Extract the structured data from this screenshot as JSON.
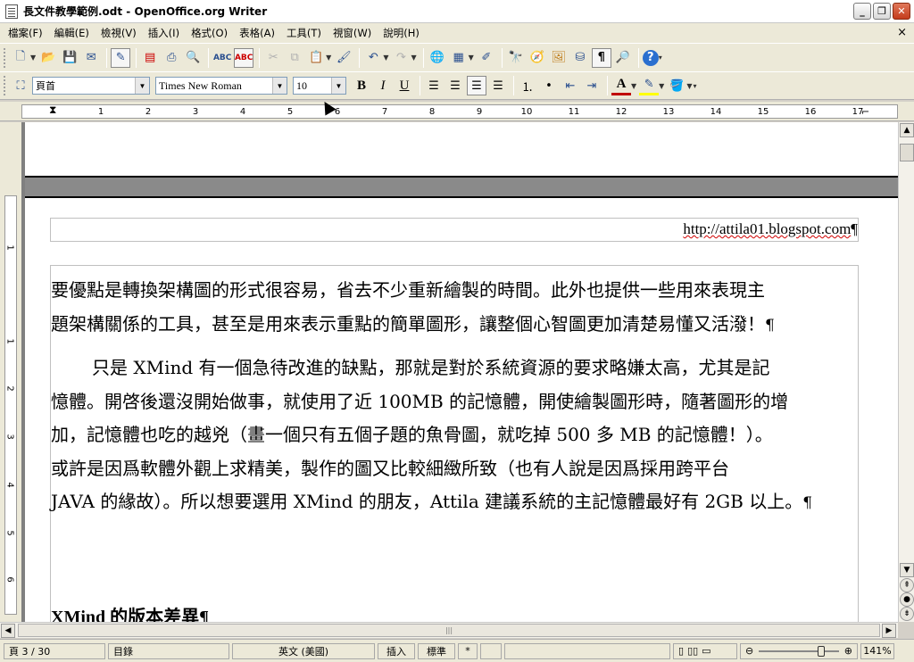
{
  "window": {
    "title": "長文件教學範例.odt - OpenOffice.org Writer",
    "minimize": "_",
    "restore": "❐",
    "close": "✕"
  },
  "menu": {
    "items": [
      "檔案(F)",
      "編輯(E)",
      "檢視(V)",
      "插入(I)",
      "格式(O)",
      "表格(A)",
      "工具(T)",
      "視窗(W)",
      "說明(H)"
    ],
    "close_doc": "×"
  },
  "formatting": {
    "paragraph_style": "頁首",
    "font_name": "Times New Roman",
    "font_size": "10",
    "bold": "B",
    "italic": "I",
    "underline": "U",
    "font_color_letter": "A"
  },
  "ruler": {
    "numbers": [
      "1",
      "2",
      "3",
      "4",
      "5",
      "6",
      "7",
      "8",
      "9",
      "10",
      "11",
      "12",
      "13",
      "14",
      "15",
      "16",
      "17"
    ],
    "vertical_numbers": [
      "1",
      "1",
      "2",
      "3",
      "4",
      "5",
      "6"
    ]
  },
  "document": {
    "header_url": "http://attila01.blogspot.com",
    "pilcrow": "¶",
    "lines": [
      "要優點是轉換架構圖的形式很容易，省去不少重新繪製的時間。此外也提供一些用來表現主",
      "題架構關係的工具，甚至是用來表示重點的簡單圖形，讓整個心智圖更加清楚易懂又活潑！",
      "只是 XMind 有一個急待改進的缺點，那就是對於系統資源的要求略嫌太高，尤其是記",
      "憶體。開啓後還沒開始做事，就使用了近 100MB 的記憶體，開使繪製圖形時，隨著圖形的增",
      "加，記憶體也吃的越兇（畫一個只有五個子題的魚骨圖，就吃掉 500 多 MB 的記憶體！）。",
      "或許是因爲軟體外觀上求精美，製作的圖又比較細緻所致（也有人說是因爲採用跨平台",
      "JAVA 的緣故）。所以想要選用 XMind 的朋友，Attila 建議系統的主記憶體最好有 2GB 以上。"
    ],
    "heading": "XMind 的版本差異"
  },
  "status": {
    "page": "頁 3 / 30",
    "style": "目錄",
    "language": "英文 (美國)",
    "insert_mode": "插入",
    "selection_mode": "標準",
    "modified": "*",
    "zoom": "141%"
  }
}
